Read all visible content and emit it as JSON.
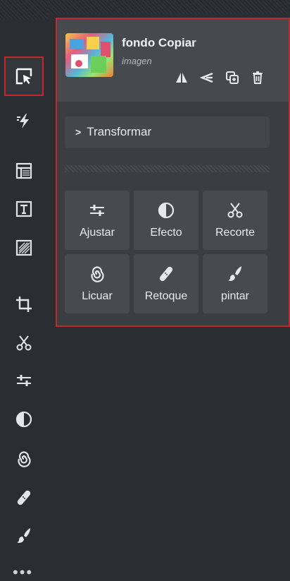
{
  "sidebar": {
    "tools": [
      {
        "name": "select-tool",
        "icon": "cursor-select-icon",
        "active": true
      },
      {
        "name": "quick-actions-tool",
        "icon": "lightning-icon"
      },
      {
        "name": "templates-tool",
        "icon": "layout-icon"
      },
      {
        "name": "text-tool",
        "icon": "text-box-icon"
      },
      {
        "name": "texture-tool",
        "icon": "texture-icon"
      },
      {
        "name": "crop-tool",
        "icon": "crop-icon"
      },
      {
        "name": "cutout-tool",
        "icon": "scissors-icon"
      },
      {
        "name": "adjust-tool",
        "icon": "sliders-icon"
      },
      {
        "name": "effect-tool",
        "icon": "contrast-icon"
      },
      {
        "name": "liquify-tool",
        "icon": "spiral-icon"
      },
      {
        "name": "retouch-tool",
        "icon": "bandage-icon"
      },
      {
        "name": "paint-tool",
        "icon": "brush-icon"
      }
    ],
    "more_label": "•••"
  },
  "layer": {
    "name": "fondo Copiar",
    "type": "imagen",
    "actions": [
      "flip-icon",
      "align-icon",
      "duplicate-icon",
      "trash-icon"
    ]
  },
  "transform": {
    "label": "Transformar",
    "chevron": ">"
  },
  "tools_grid": [
    {
      "label": "Ajustar",
      "icon": "sliders-icon"
    },
    {
      "label": "Efecto",
      "icon": "contrast-icon"
    },
    {
      "label": "Recorte",
      "icon": "scissors-icon"
    },
    {
      "label": "Licuar",
      "icon": "spiral-icon"
    },
    {
      "label": "Retoque",
      "icon": "bandage-icon"
    },
    {
      "label": "pintar",
      "icon": "brush-icon"
    }
  ],
  "colors": {
    "accent": "#c1272d",
    "text": "#e9ebed",
    "panel": "#3a3e43"
  }
}
